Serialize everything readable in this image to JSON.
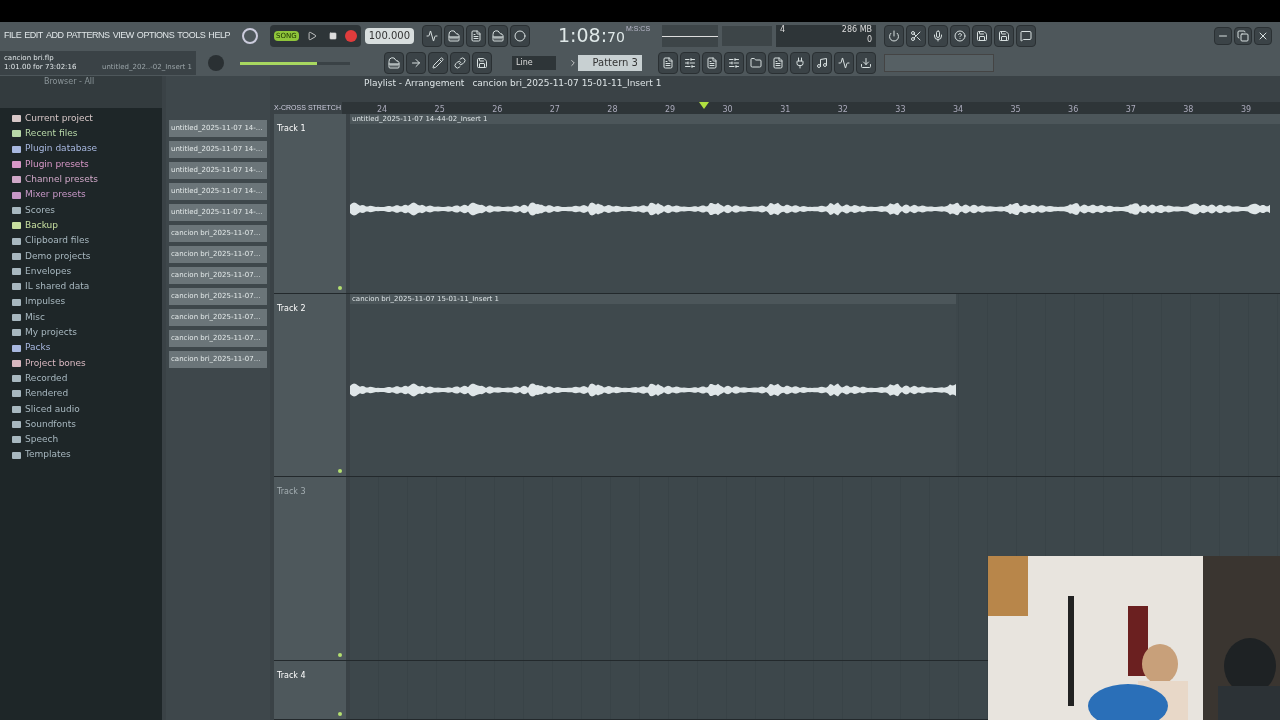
{
  "menu": [
    "FILE",
    "EDIT",
    "ADD",
    "PATTERNS",
    "VIEW",
    "OPTIONS",
    "TOOLS",
    "HELP"
  ],
  "hint_panel": {
    "file": "cancion bri.flp",
    "position": "1:01.00 for 73:02:16",
    "clip": "untitled_202..-02_Insert 1"
  },
  "transport": {
    "mode": {
      "label": "SONG",
      "selected": true
    },
    "tempo": "100.000",
    "recording": true,
    "time": "1:08:",
    "time_cs": "70",
    "time_unit": "M:S:CS",
    "cpu": "4",
    "memory": "286 MB",
    "polyphony": "0",
    "master_volume": {
      "level": 0.7
    }
  },
  "snap": "Line",
  "pattern": "Pattern 3",
  "browser": {
    "title": "Browser - All",
    "items": [
      {
        "label": "Current project",
        "color": "#d8c8c8"
      },
      {
        "label": "Recent files",
        "color": "#b8d8a8"
      },
      {
        "label": "Plugin database",
        "color": "#a8b8e0"
      },
      {
        "label": "Plugin presets",
        "color": "#d898c8"
      },
      {
        "label": "Channel presets",
        "color": "#d0a8c8"
      },
      {
        "label": "Mixer presets",
        "color": "#c898c8"
      },
      {
        "label": "Scores",
        "color": "#a8b8c0"
      },
      {
        "label": "Backup",
        "color": "#c8e0a0"
      },
      {
        "label": "Clipboard files",
        "color": "#a8b8c0"
      },
      {
        "label": "Demo projects",
        "color": "#a8b8c0"
      },
      {
        "label": "Envelopes",
        "color": "#a8b8c0"
      },
      {
        "label": "IL shared data",
        "color": "#a8b8c0"
      },
      {
        "label": "Impulses",
        "color": "#a8b8c0"
      },
      {
        "label": "Misc",
        "color": "#a8b8c0"
      },
      {
        "label": "My projects",
        "color": "#a8b8c0"
      },
      {
        "label": "Packs",
        "color": "#a8b8e0"
      },
      {
        "label": "Project bones",
        "color": "#d8b8c0"
      },
      {
        "label": "Recorded",
        "color": "#a8b8c0"
      },
      {
        "label": "Rendered",
        "color": "#a8b8c0"
      },
      {
        "label": "Sliced audio",
        "color": "#a8b8c0"
      },
      {
        "label": "Soundfonts",
        "color": "#a8b8c0"
      },
      {
        "label": "Speech",
        "color": "#a8b8c0"
      },
      {
        "label": "Templates",
        "color": "#a8b8c0"
      }
    ]
  },
  "clip_picker": [
    "untitled_2025-11-07 14-...",
    "untitled_2025-11-07 14-...",
    "untitled_2025-11-07 14-...",
    "untitled_2025-11-07 14-...",
    "untitled_2025-11-07 14-...",
    "cancion bri_2025-11-07...",
    "cancion bri_2025-11-07...",
    "cancion bri_2025-11-07...",
    "cancion bri_2025-11-07...",
    "cancion bri_2025-11-07...",
    "cancion bri_2025-11-07...",
    "cancion bri_2025-11-07..."
  ],
  "playlist": {
    "title": "Playlist - Arrangement",
    "current_clip": "cancion bri_2025-11-07 15-01-11_Insert 1",
    "xfade_label": "X-CROSS",
    "stretch_label": "STRETCH",
    "ruler": [
      "24",
      "25",
      "26",
      "27",
      "28",
      "29",
      "30",
      "31",
      "32",
      "33",
      "34",
      "35",
      "36",
      "37",
      "38",
      "39"
    ],
    "tracks": [
      {
        "name": "Track 1",
        "dim": false,
        "clip": {
          "label": "untitled_2025-11-07 14-44-02_Insert 1",
          "full": true
        }
      },
      {
        "name": "Track 2",
        "dim": false,
        "clip": {
          "label": "cancion bri_2025-11-07 15-01-11_Insert 1",
          "full": false
        }
      },
      {
        "name": "Track 3",
        "dim": true
      },
      {
        "name": "Track 4",
        "dim": false
      }
    ]
  }
}
